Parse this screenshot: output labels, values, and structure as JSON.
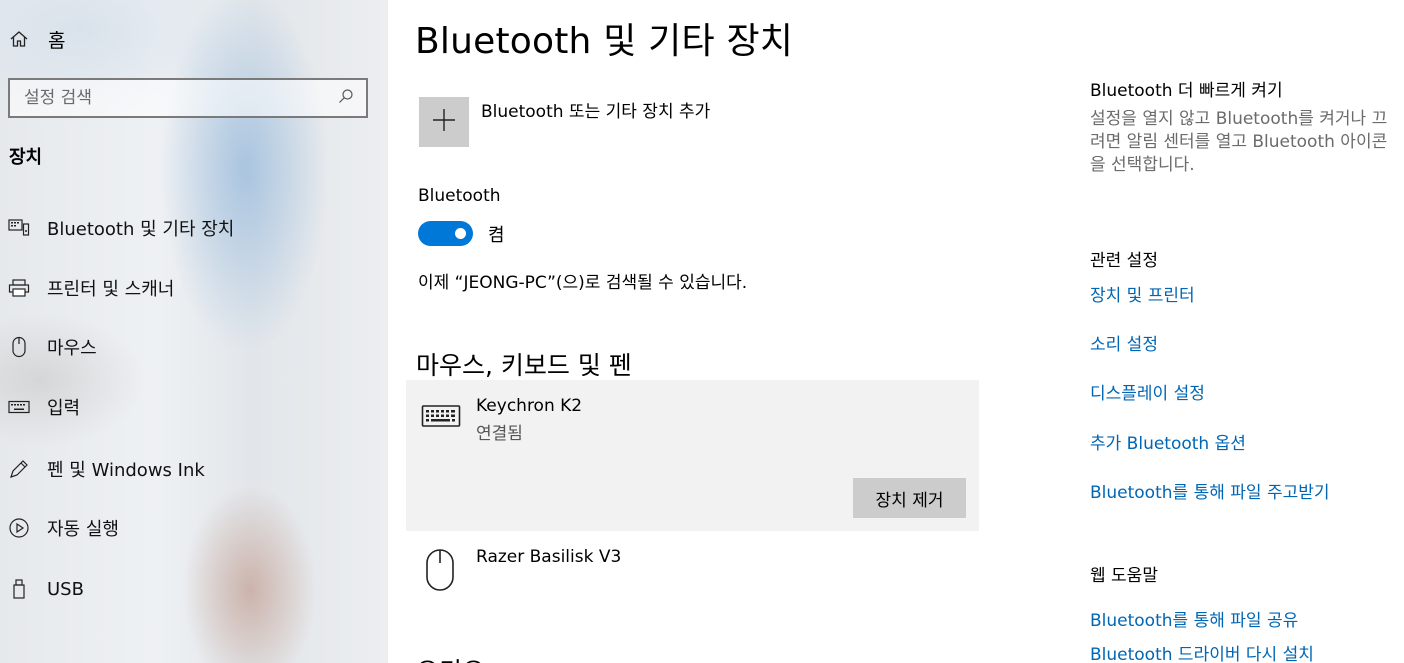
{
  "sidebar": {
    "home_label": "홈",
    "search_placeholder": "설정 검색",
    "section_label": "장치",
    "items": [
      {
        "label": "Bluetooth 및 기타 장치"
      },
      {
        "label": "프린터 및 스캐너"
      },
      {
        "label": "마우스"
      },
      {
        "label": "입력"
      },
      {
        "label": "펜 및 Windows Ink"
      },
      {
        "label": "자동 실행"
      },
      {
        "label": "USB"
      }
    ]
  },
  "main": {
    "title": "Bluetooth 및 기타 장치",
    "add_device_label": "Bluetooth 또는 기타 장치 추가",
    "bluetooth_label": "Bluetooth",
    "toggle_state": "켬",
    "discoverable_text": "이제 “JEONG-PC”(으)로 검색될 수 있습니다.",
    "section_title": "마우스, 키보드 및 펜",
    "devices": [
      {
        "name": "Keychron K2",
        "status": "연결됨",
        "icon": "keyboard-icon",
        "action": "장치 제거"
      },
      {
        "name": "Razer Basilisk V3",
        "icon": "mouse-icon"
      }
    ],
    "next_section_title": "오디오"
  },
  "right": {
    "quick_title": "Bluetooth 더 빠르게 켜기",
    "quick_desc": "설정을 열지 않고 Bluetooth를 켜거나 끄려면 알림 센터를 열고 Bluetooth 아이콘을 선택합니다.",
    "related_title": "관련 설정",
    "related_links": [
      "장치 및 프린터",
      "소리 설정",
      "디스플레이 설정",
      "추가 Bluetooth 옵션",
      "Bluetooth를 통해 파일 주고받기"
    ],
    "help_title": "웹 도움말",
    "help_links": [
      "Bluetooth를 통해 파일 공유",
      "Bluetooth 드라이버 다시 설치"
    ]
  },
  "colors": {
    "accent": "#0078d7",
    "link": "#0066b4",
    "tile": "#cccccc",
    "selected_row": "#f2f2f2"
  }
}
